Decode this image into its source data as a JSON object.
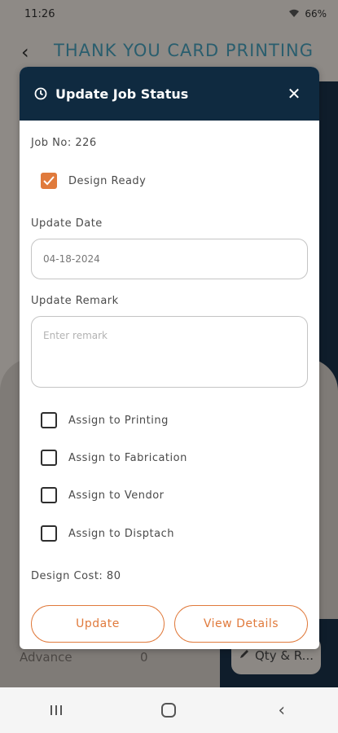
{
  "status_bar": {
    "time": "11:26",
    "battery": "66%"
  },
  "app": {
    "title": "THANK YOU CARD PRINTING"
  },
  "background": {
    "rows": [
      {
        "label": "Advance",
        "value": "0"
      }
    ],
    "qty_button": "Qty & R..."
  },
  "modal": {
    "title": "Update Job Status",
    "job_no": "Job No: 226",
    "design_ready": {
      "label": "Design Ready",
      "checked": true
    },
    "update_date": {
      "label": "Update Date",
      "value": "04-18-2024"
    },
    "update_remark": {
      "label": "Update Remark",
      "placeholder": "Enter remark"
    },
    "assignments": [
      {
        "label": "Assign to Printing",
        "checked": false
      },
      {
        "label": "Assign to Fabrication",
        "checked": false
      },
      {
        "label": "Assign to Vendor",
        "checked": false
      },
      {
        "label": "Assign to Disptach",
        "checked": false
      }
    ],
    "design_cost": "Design Cost: 80",
    "buttons": {
      "update": "Update",
      "view_details": "View Details"
    }
  },
  "colors": {
    "accent": "#e07a3c",
    "header": "#0f2a40",
    "title": "#2a5e6e"
  }
}
